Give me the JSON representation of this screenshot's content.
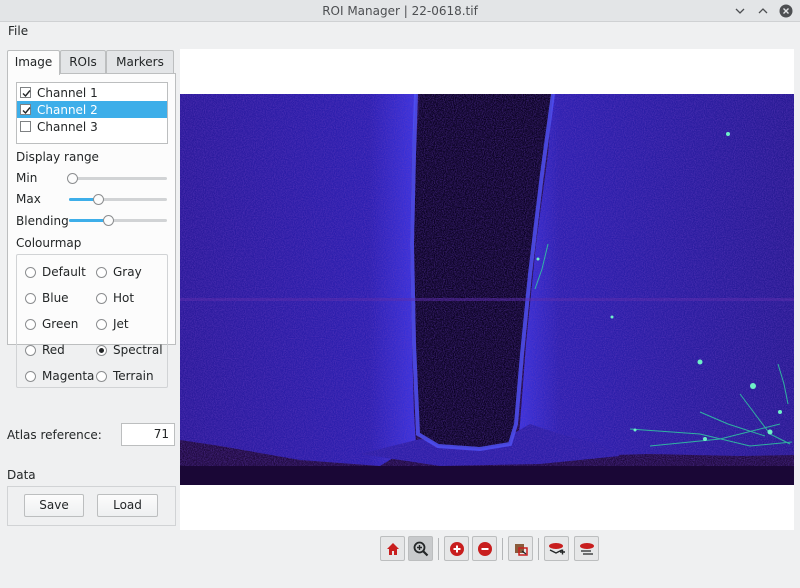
{
  "window": {
    "title": "ROI Manager   |   22-0618.tif"
  },
  "menu": {
    "file": "File"
  },
  "tabs": [
    {
      "label": "Image",
      "active": true
    },
    {
      "label": "ROIs",
      "active": false
    },
    {
      "label": "Markers",
      "active": false
    }
  ],
  "channels": [
    {
      "label": "Channel 1",
      "checked": true,
      "selected": false
    },
    {
      "label": "Channel 2",
      "checked": true,
      "selected": true
    },
    {
      "label": "Channel 3",
      "checked": false,
      "selected": false
    }
  ],
  "display_range": {
    "heading": "Display range",
    "min_label": "Min",
    "max_label": "Max",
    "blending_label": "Blending",
    "min_value": 0.03,
    "max_value": 0.3,
    "blending_value": 0.4
  },
  "colourmap": {
    "heading": "Colourmap",
    "options": [
      "Default",
      "Gray",
      "Blue",
      "Hot",
      "Green",
      "Jet",
      "Red",
      "Spectral",
      "Magenta",
      "Terrain"
    ],
    "selected": "Spectral"
  },
  "atlas": {
    "label": "Atlas reference:",
    "value": "71"
  },
  "data_section": {
    "heading": "Data",
    "save_label": "Save",
    "load_label": "Load"
  },
  "toolbar": {
    "icons": [
      "home-icon",
      "zoom-icon",
      "zoom-in-icon",
      "zoom-out-icon",
      "fit-icon",
      "add-marker-icon",
      "remove-marker-icon"
    ]
  },
  "colors": {
    "accent": "#3daee9",
    "image_bg": "#22094a",
    "tissue_blue": "#2d1fb8",
    "toolbar_red": "#c81e1e"
  }
}
